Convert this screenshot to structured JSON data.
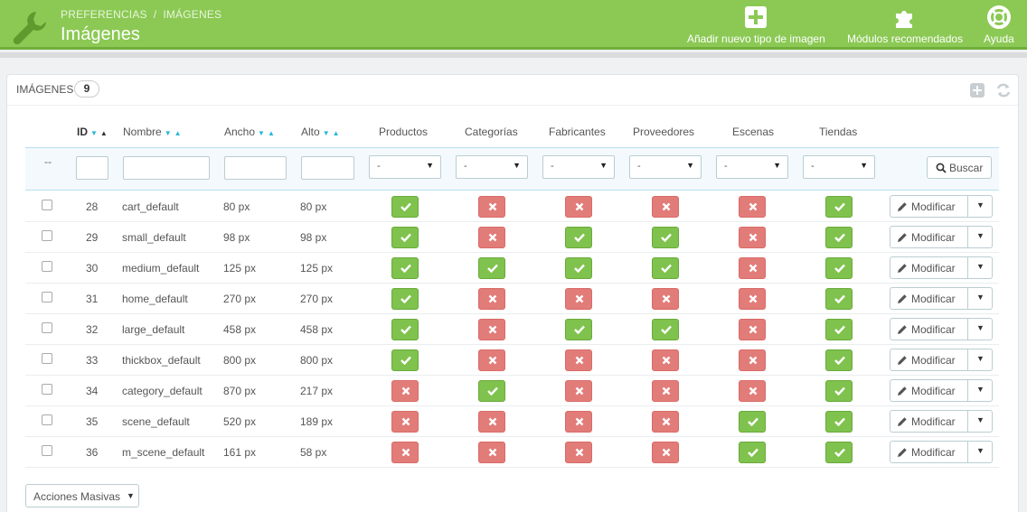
{
  "header": {
    "breadcrumb": [
      "PREFERENCIAS",
      "IMÁGENES"
    ],
    "breadcrumb_sep": "/",
    "title": "Imágenes",
    "toolbar": [
      {
        "label": "Añadir nuevo tipo de imagen",
        "icon": "plus-square-icon"
      },
      {
        "label": "Módulos recomendados",
        "icon": "puzzle-icon"
      },
      {
        "label": "Ayuda",
        "icon": "lifebuoy-icon"
      }
    ],
    "brand_color": "#8bc954"
  },
  "panel": {
    "title": "IMÁGENES",
    "count": "9"
  },
  "table": {
    "columns": [
      "ID",
      "Nombre",
      "Ancho",
      "Alto",
      "Productos",
      "Categorías",
      "Fabricantes",
      "Proveedores",
      "Escenas",
      "Tiendas"
    ],
    "filter_placeholder": "--",
    "select_value": "-",
    "search_label": "Buscar",
    "rows": [
      {
        "id": "28",
        "name": "cart_default",
        "width": "80 px",
        "height": "80 px",
        "flags": [
          true,
          false,
          false,
          false,
          false,
          true
        ]
      },
      {
        "id": "29",
        "name": "small_default",
        "width": "98 px",
        "height": "98 px",
        "flags": [
          true,
          false,
          true,
          true,
          false,
          true
        ]
      },
      {
        "id": "30",
        "name": "medium_default",
        "width": "125 px",
        "height": "125 px",
        "flags": [
          true,
          true,
          true,
          true,
          false,
          true
        ]
      },
      {
        "id": "31",
        "name": "home_default",
        "width": "270 px",
        "height": "270 px",
        "flags": [
          true,
          false,
          false,
          false,
          false,
          true
        ]
      },
      {
        "id": "32",
        "name": "large_default",
        "width": "458 px",
        "height": "458 px",
        "flags": [
          true,
          false,
          true,
          true,
          false,
          true
        ]
      },
      {
        "id": "33",
        "name": "thickbox_default",
        "width": "800 px",
        "height": "800 px",
        "flags": [
          true,
          false,
          false,
          false,
          false,
          true
        ]
      },
      {
        "id": "34",
        "name": "category_default",
        "width": "870 px",
        "height": "217 px",
        "flags": [
          false,
          true,
          false,
          false,
          false,
          true
        ]
      },
      {
        "id": "35",
        "name": "scene_default",
        "width": "520 px",
        "height": "189 px",
        "flags": [
          false,
          false,
          false,
          false,
          true,
          true
        ]
      },
      {
        "id": "36",
        "name": "m_scene_default",
        "width": "161 px",
        "height": "58 px",
        "flags": [
          false,
          false,
          false,
          false,
          true,
          true
        ]
      }
    ],
    "edit_label": "Modificar",
    "bulk_label": "Acciones Masivas",
    "status_colors": {
      "yes": "#7fc24d",
      "no": "#e27c79"
    }
  }
}
